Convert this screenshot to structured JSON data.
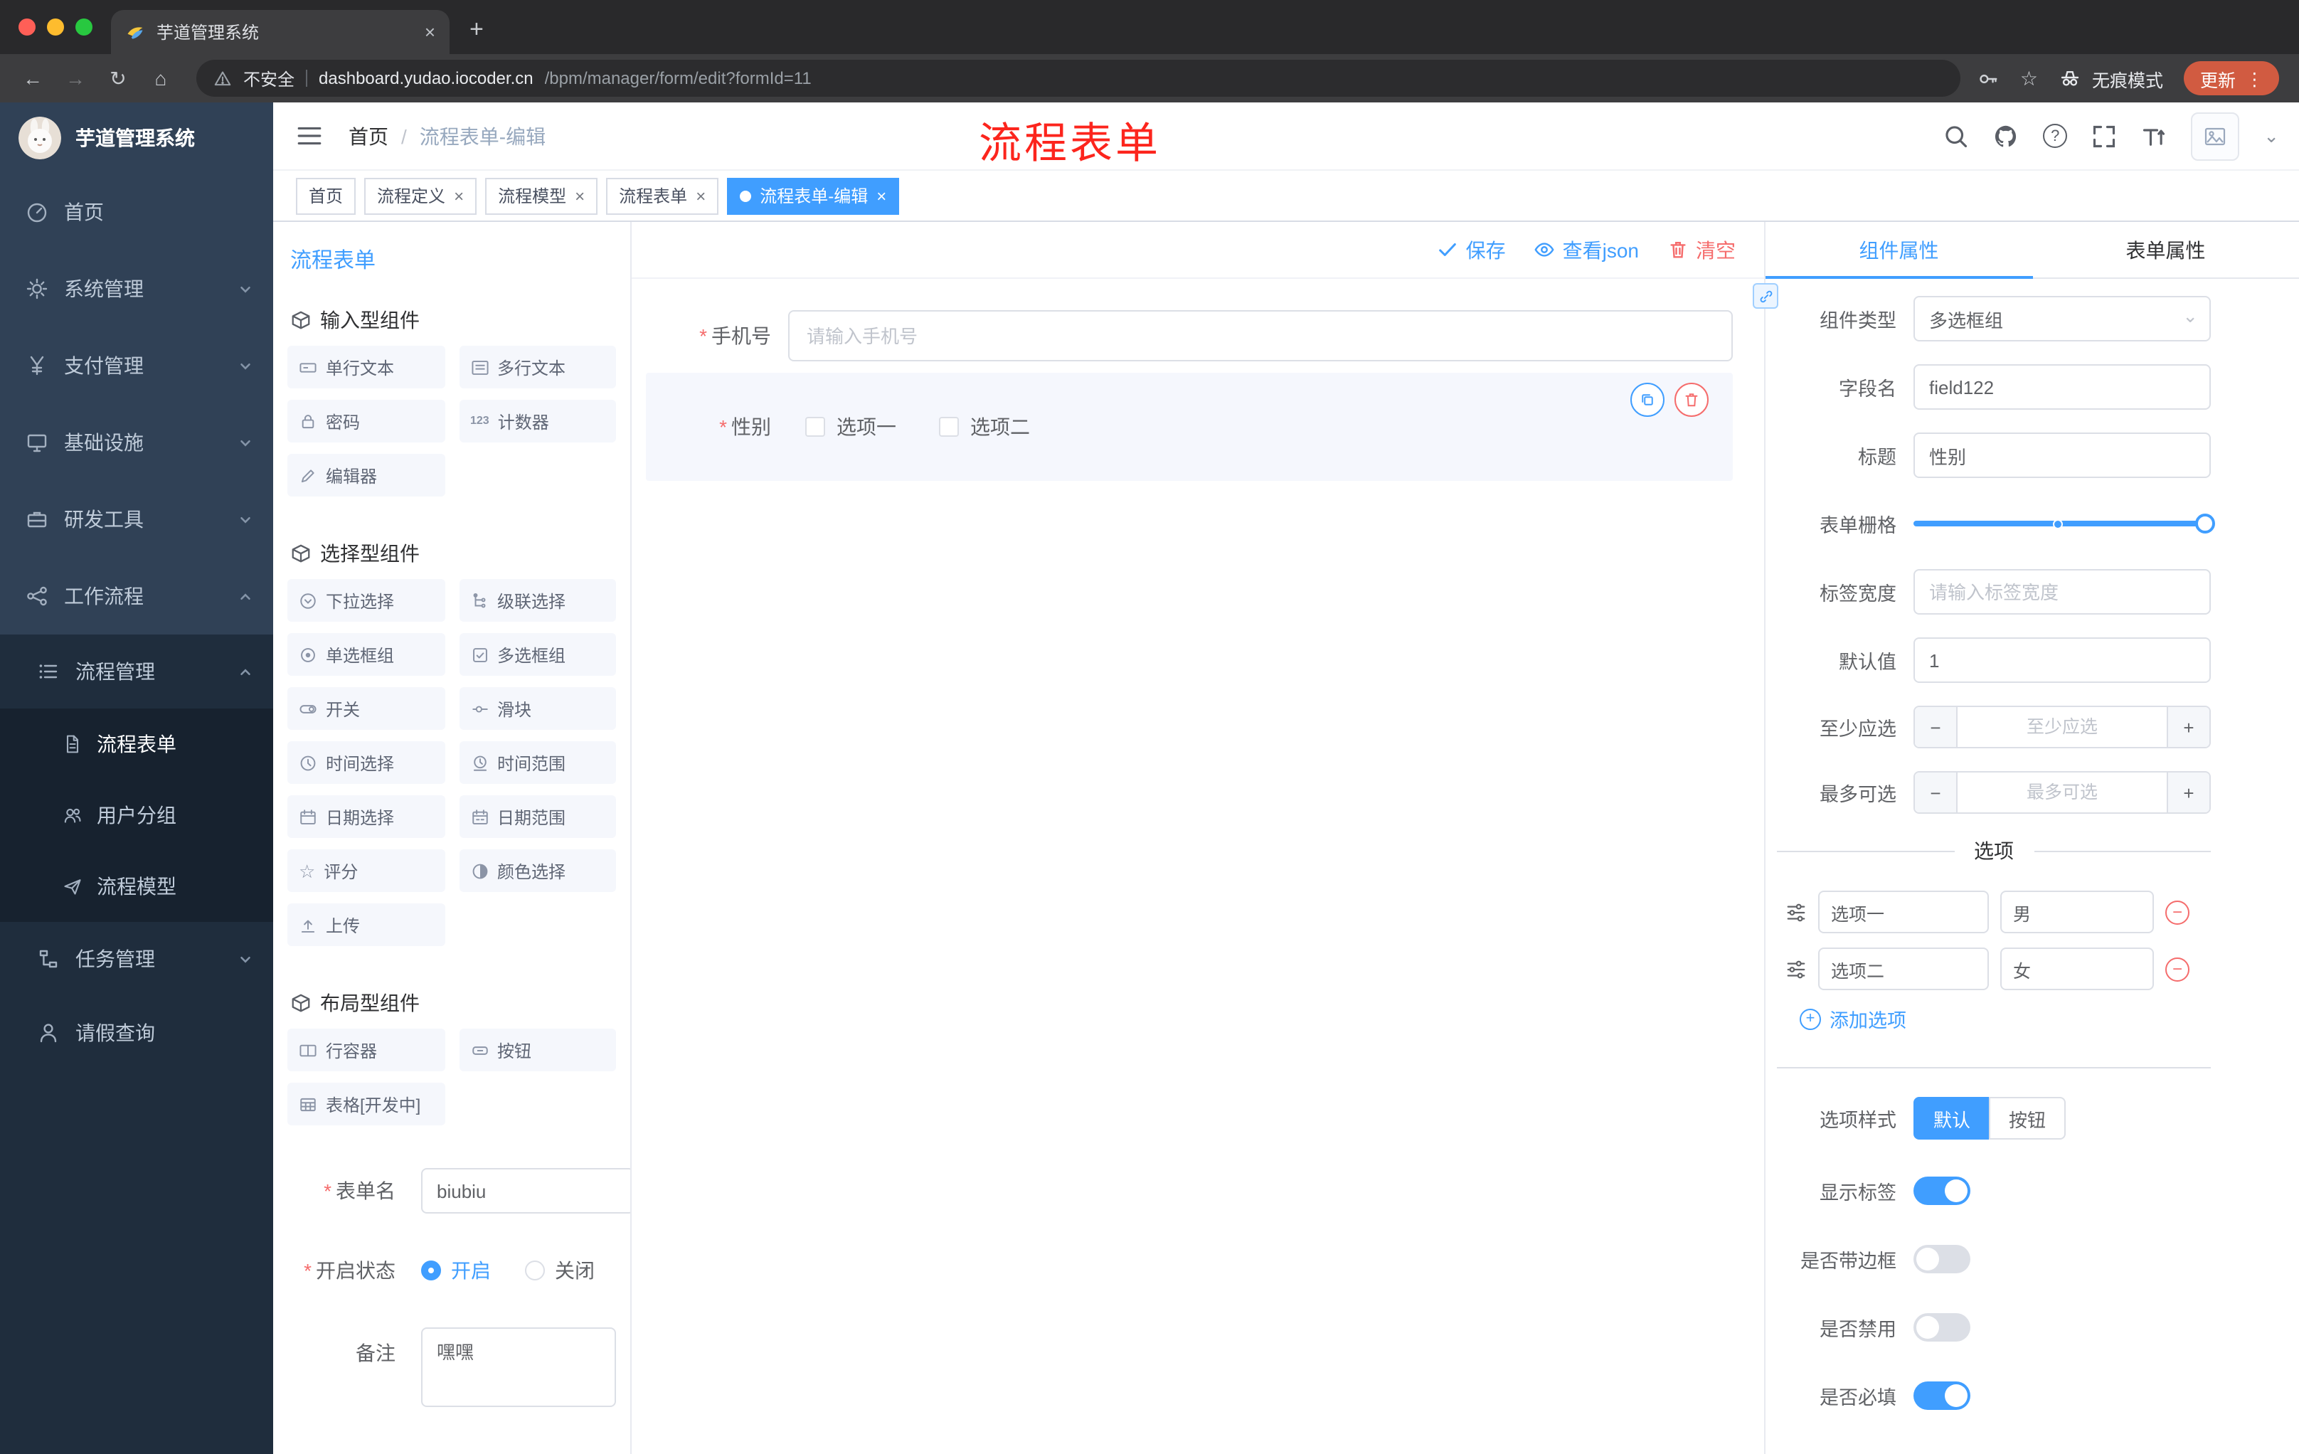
{
  "colors": {
    "primary": "#409eff",
    "danger": "#f56c6c",
    "annotation_red": "#fc251d",
    "sidebar_bg": "#304156",
    "submenu_bg": "#1f2d3d",
    "update_pill": "#d15b41"
  },
  "glyphs": {
    "back": "←",
    "forward": "→",
    "reload": "↻",
    "home": "⌂",
    "plus": "+",
    "close": "×",
    "more": "⋮",
    "star": "☆",
    "caret": "⌄",
    "question": "?",
    "required": "*",
    "minus": "−",
    "counter": "123",
    "slash": "/"
  },
  "browser": {
    "tab_title": "芋道管理系统",
    "security_label": "不安全",
    "url_host": "dashboard.yudao.iocoder.cn",
    "url_path": "/bpm/manager/form/edit?formId=11",
    "incognito_label": "无痕模式",
    "update_label": "更新"
  },
  "sidebar": {
    "logo_title": "芋道管理系统",
    "items": [
      {
        "label": "首页"
      },
      {
        "label": "系统管理"
      },
      {
        "label": "支付管理"
      },
      {
        "label": "基础设施"
      },
      {
        "label": "研发工具"
      },
      {
        "label": "工作流程"
      },
      {
        "label": "流程管理"
      },
      {
        "label": "流程表单"
      },
      {
        "label": "用户分组"
      },
      {
        "label": "流程模型"
      },
      {
        "label": "任务管理"
      },
      {
        "label": "请假查询"
      }
    ]
  },
  "header": {
    "breadcrumb_home": "首页",
    "breadcrumb_current": "流程表单-编辑",
    "annotation": "流程表单"
  },
  "tags": [
    {
      "label": "首页",
      "closable": false,
      "active": false
    },
    {
      "label": "流程定义",
      "closable": true,
      "active": false
    },
    {
      "label": "流程模型",
      "closable": true,
      "active": false
    },
    {
      "label": "流程表单",
      "closable": true,
      "active": false
    },
    {
      "label": "流程表单-编辑",
      "closable": true,
      "active": true
    }
  ],
  "palette": {
    "title": "流程表单",
    "group_input": {
      "title": "输入型组件",
      "items": [
        "单行文本",
        "多行文本",
        "密码",
        "计数器",
        "编辑器"
      ]
    },
    "group_select": {
      "title": "选择型组件",
      "items": [
        "下拉选择",
        "级联选择",
        "单选框组",
        "多选框组",
        "开关",
        "滑块",
        "时间选择",
        "时间范围",
        "日期选择",
        "日期范围",
        "评分",
        "颜色选择",
        "上传"
      ]
    },
    "group_layout": {
      "title": "布局型组件",
      "items": [
        "行容器",
        "按钮",
        "表格[开发中]"
      ]
    },
    "form": {
      "name_label": "表单名",
      "name_value": "biubiu",
      "status_label": "开启状态",
      "status_on": "开启",
      "status_off": "关闭",
      "status_value": "开启",
      "remark_label": "备注",
      "remark_value": "嘿嘿"
    }
  },
  "canvas": {
    "save": "保存",
    "view_json": "查看json",
    "clear": "清空",
    "phone_label": "手机号",
    "phone_placeholder": "请输入手机号",
    "gender_label": "性别",
    "gender_opt1": "选项一",
    "gender_opt2": "选项二"
  },
  "props": {
    "tab_component": "组件属性",
    "tab_form": "表单属性",
    "active_tab": "组件属性",
    "type_label": "组件类型",
    "type_value": "多选框组",
    "field_label": "字段名",
    "field_value": "field122",
    "title_label": "标题",
    "title_value": "性别",
    "grid_label": "表单栅格",
    "width_label": "标签宽度",
    "width_placeholder": "请输入标签宽度",
    "default_label": "默认值",
    "default_value": "1",
    "min_label": "至少应选",
    "min_placeholder": "至少应选",
    "max_label": "最多可选",
    "max_placeholder": "最多可选",
    "options_title": "选项",
    "options": [
      {
        "name": "选项一",
        "value": "男"
      },
      {
        "name": "选项二",
        "value": "女"
      }
    ],
    "add_option": "添加选项",
    "style_label": "选项样式",
    "style_default": "默认",
    "style_button": "按钮",
    "style_value": "默认",
    "switches": [
      {
        "label": "显示标签",
        "on": true
      },
      {
        "label": "是否带边框",
        "on": false
      },
      {
        "label": "是否禁用",
        "on": false
      },
      {
        "label": "是否必填",
        "on": true
      }
    ]
  }
}
